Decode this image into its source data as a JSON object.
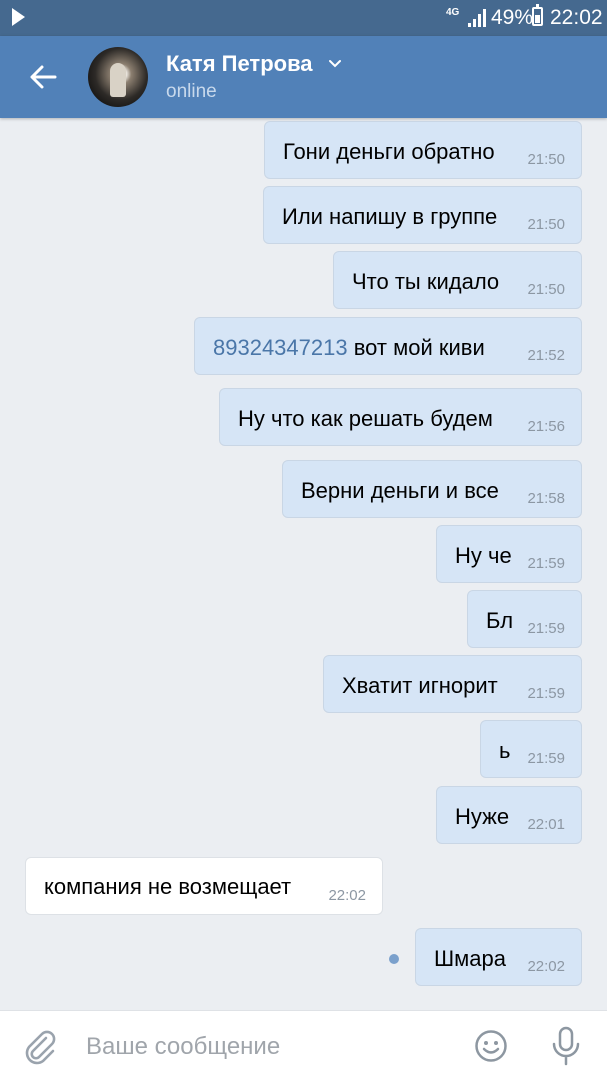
{
  "status_bar": {
    "network": "4G",
    "battery": "49%",
    "time": "22:02",
    "icons": [
      "play-icon",
      "signal-icon",
      "battery-icon"
    ]
  },
  "header": {
    "name": "Катя Петрова",
    "status": "online",
    "icons": [
      "back-arrow-icon",
      "avatar",
      "chevron-down-icon"
    ],
    "color": "#5181b8"
  },
  "messages": [
    {
      "dir": "out",
      "text": "Гони деньги обратно",
      "time": "21:50"
    },
    {
      "dir": "out",
      "text": "Или напишу в группе",
      "time": "21:50"
    },
    {
      "dir": "out",
      "text": "Что ты кидало",
      "time": "21:50"
    },
    {
      "dir": "out",
      "link": "89324347213",
      "text": " вот мой киви",
      "time": "21:52"
    },
    {
      "dir": "out",
      "text": "Ну что как решать будем",
      "time": "21:56"
    },
    {
      "dir": "out",
      "text": "Верни деньги и все",
      "time": "21:58"
    },
    {
      "dir": "out",
      "text": "Ну че",
      "time": "21:59"
    },
    {
      "dir": "out",
      "text": "Бл",
      "time": "21:59"
    },
    {
      "dir": "out",
      "text": "Хватит игнорит",
      "time": "21:59"
    },
    {
      "dir": "out",
      "text": "ь",
      "time": "21:59"
    },
    {
      "dir": "out",
      "text": "Нуже",
      "time": "22:01"
    },
    {
      "dir": "in",
      "text": "компания не возмещает",
      "time": "22:02"
    },
    {
      "dir": "out",
      "text": "Шмара",
      "time": "22:02",
      "unread": true
    }
  ],
  "composer": {
    "placeholder": "Ваше сообщение",
    "icons": [
      "paperclip-icon",
      "emoji-icon",
      "microphone-icon"
    ]
  },
  "colors": {
    "outgoing_bubble": "#d6e5f6",
    "incoming_bubble": "#ffffff",
    "link": "#4a76a8",
    "background": "#ebeef2"
  }
}
